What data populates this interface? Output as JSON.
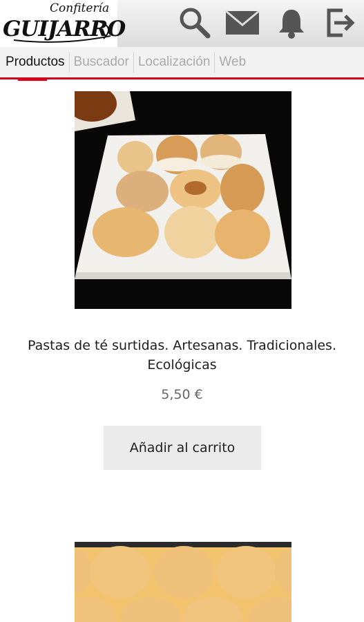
{
  "logo": {
    "top_text": "Confitería",
    "brand_text": "GUIJARRO"
  },
  "header": {
    "actions": [
      {
        "icon": "search-icon"
      },
      {
        "icon": "mail-icon"
      },
      {
        "icon": "bell-icon"
      },
      {
        "icon": "logout-icon"
      }
    ]
  },
  "tabs": [
    {
      "label": "Productos",
      "active": true
    },
    {
      "label": "Buscador",
      "active": false
    },
    {
      "label": "Localización",
      "active": false
    },
    {
      "label": "Web",
      "active": false
    }
  ],
  "colors": {
    "accent": "#e2001a",
    "header_bg": "#e4e4e4",
    "button_bg": "#ebebeb"
  },
  "products": [
    {
      "title": "Pastas de té surtidas. Artesanas. Tradicionales. Ecológicas",
      "price": "5,50 €",
      "button_label": "Añadir al carrito"
    }
  ]
}
